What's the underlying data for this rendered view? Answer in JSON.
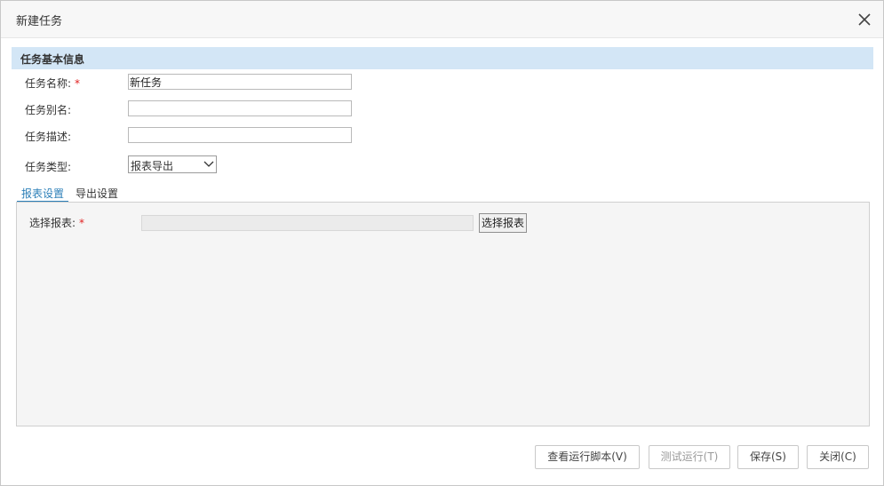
{
  "dialog": {
    "title": "新建任务"
  },
  "section": {
    "title": "任务基本信息"
  },
  "form": {
    "name_label": "任务名称:",
    "required_mark": "*",
    "name_value": "新任务",
    "alias_label": "任务别名:",
    "alias_value": "",
    "desc_label": "任务描述:",
    "desc_value": "",
    "type_label": "任务类型:",
    "type_value": "报表导出"
  },
  "tabs": [
    {
      "label": "报表设置",
      "active": true
    },
    {
      "label": "导出设置",
      "active": false
    }
  ],
  "report_panel": {
    "label": "选择报表:",
    "required_mark": "*",
    "field_value": "",
    "choose_button": "选择报表"
  },
  "footer": {
    "view_script": "查看运行脚本(V)",
    "test_run": "测试运行(T)",
    "save": "保存(S)",
    "close": "关闭(C)"
  },
  "colors": {
    "section_bg": "#d3e6f6",
    "active_tab": "#2c7fb8",
    "required": "#e02020"
  }
}
